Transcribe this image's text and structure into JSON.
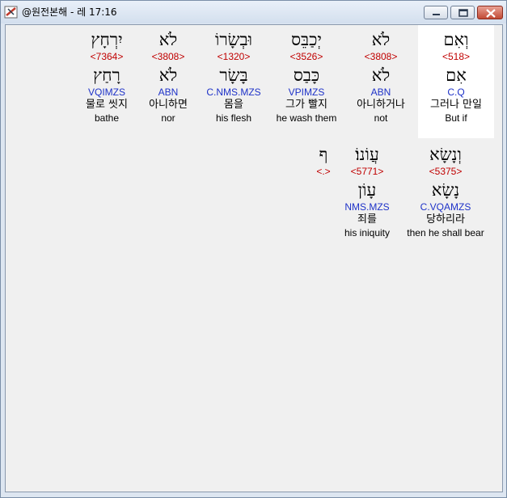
{
  "window": {
    "title": "@원전본해 - 레 17:16"
  },
  "words": [
    {
      "hebrew": "וְאִם",
      "strong": "<518>",
      "lemma": "אִם",
      "parse": "C.Q",
      "korean": "그러나 만일",
      "english": "But if"
    },
    {
      "hebrew": "לֹא",
      "strong": "<3808>",
      "lemma": "לֹא",
      "parse": "ABN",
      "korean": "아니하거나",
      "english": "not"
    },
    {
      "hebrew": "יְכַבֵּס",
      "strong": "<3526>",
      "lemma": "כָּבַס",
      "parse": "VPIMZS",
      "korean": "그가 빨지",
      "english": "he wash them"
    },
    {
      "hebrew": "וּבְשָׂרוֹ",
      "strong": "<1320>",
      "lemma": "בָּשָׂר",
      "parse": "C.NMS.MZS",
      "korean": "몸을",
      "english": "his flesh"
    },
    {
      "hebrew": "לֹא",
      "strong": "<3808>",
      "lemma": "לֹא",
      "parse": "ABN",
      "korean": "아니하면",
      "english": "nor"
    },
    {
      "hebrew": "יִרְחָץ",
      "strong": "<7364>",
      "lemma": "רָחַץ",
      "parse": "VQIMZS",
      "korean": "물로 씻지",
      "english": "bathe"
    },
    {
      "hebrew": "וְנָשָׂא",
      "strong": "<5375>",
      "lemma": "נָשָׂא",
      "parse": "C.VQAMZS",
      "korean": "당하리라",
      "english": "then he shall bear"
    },
    {
      "hebrew": "עֲוֹנוֹ׃",
      "strong": "<5771>",
      "lemma": "עָוֹן",
      "parse": "NMS.MZS",
      "korean": "죄를",
      "english": "his iniquity"
    },
    {
      "hebrew": "ף",
      "strong": "<.>",
      "lemma": "",
      "parse": "",
      "korean": "",
      "english": ""
    }
  ]
}
